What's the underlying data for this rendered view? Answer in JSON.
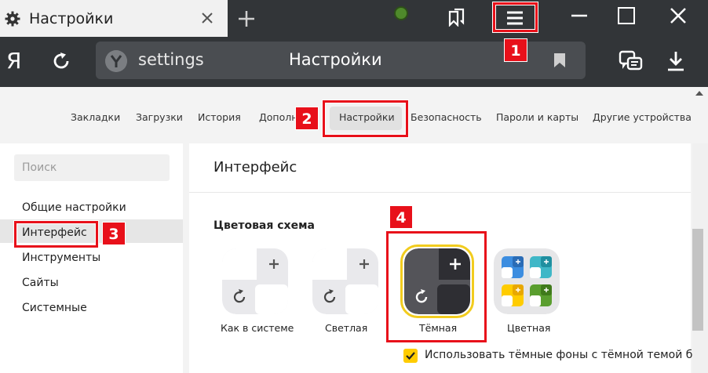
{
  "tab": {
    "title": "Настройки"
  },
  "address": {
    "url": "settings",
    "page_title": "Настройки",
    "logo": "Я"
  },
  "nav": {
    "items": [
      "Закладки",
      "Загрузки",
      "История",
      "Дополн",
      "Настройки",
      "Безопасность",
      "Пароли и карты",
      "Другие устройства"
    ],
    "active": "Настройки"
  },
  "sidebar": {
    "search_placeholder": "Поиск",
    "items": [
      "Общие настройки",
      "Интерфейс",
      "Инструменты",
      "Сайты",
      "Системные"
    ],
    "active": "Интерфейс"
  },
  "main": {
    "title": "Интерфейс",
    "color_scheme_title": "Цветовая схема",
    "schemes": [
      "Как в системе",
      "Светлая",
      "Тёмная",
      "Цветная"
    ],
    "selected_scheme": "Тёмная",
    "dark_backgrounds_label": "Использовать тёмные фоны с тёмной темой браузера",
    "dark_backgrounds_checked": true
  },
  "annotations": [
    "1",
    "2",
    "3",
    "4"
  ],
  "colors": {
    "chrome": "#323538",
    "omnibox": "#4a4d51",
    "accent_yellow": "#ffcc00",
    "annotation_red": "#e8101a"
  },
  "icons": [
    "gear-icon",
    "close-icon",
    "plus-icon",
    "extension-icon",
    "bookmarks-manager-icon",
    "menu-icon",
    "minimize-icon",
    "maximize-icon",
    "window-close-icon",
    "reload-icon",
    "site-icon",
    "bookmark-icon",
    "tabs-icon",
    "download-icon",
    "check-icon"
  ]
}
